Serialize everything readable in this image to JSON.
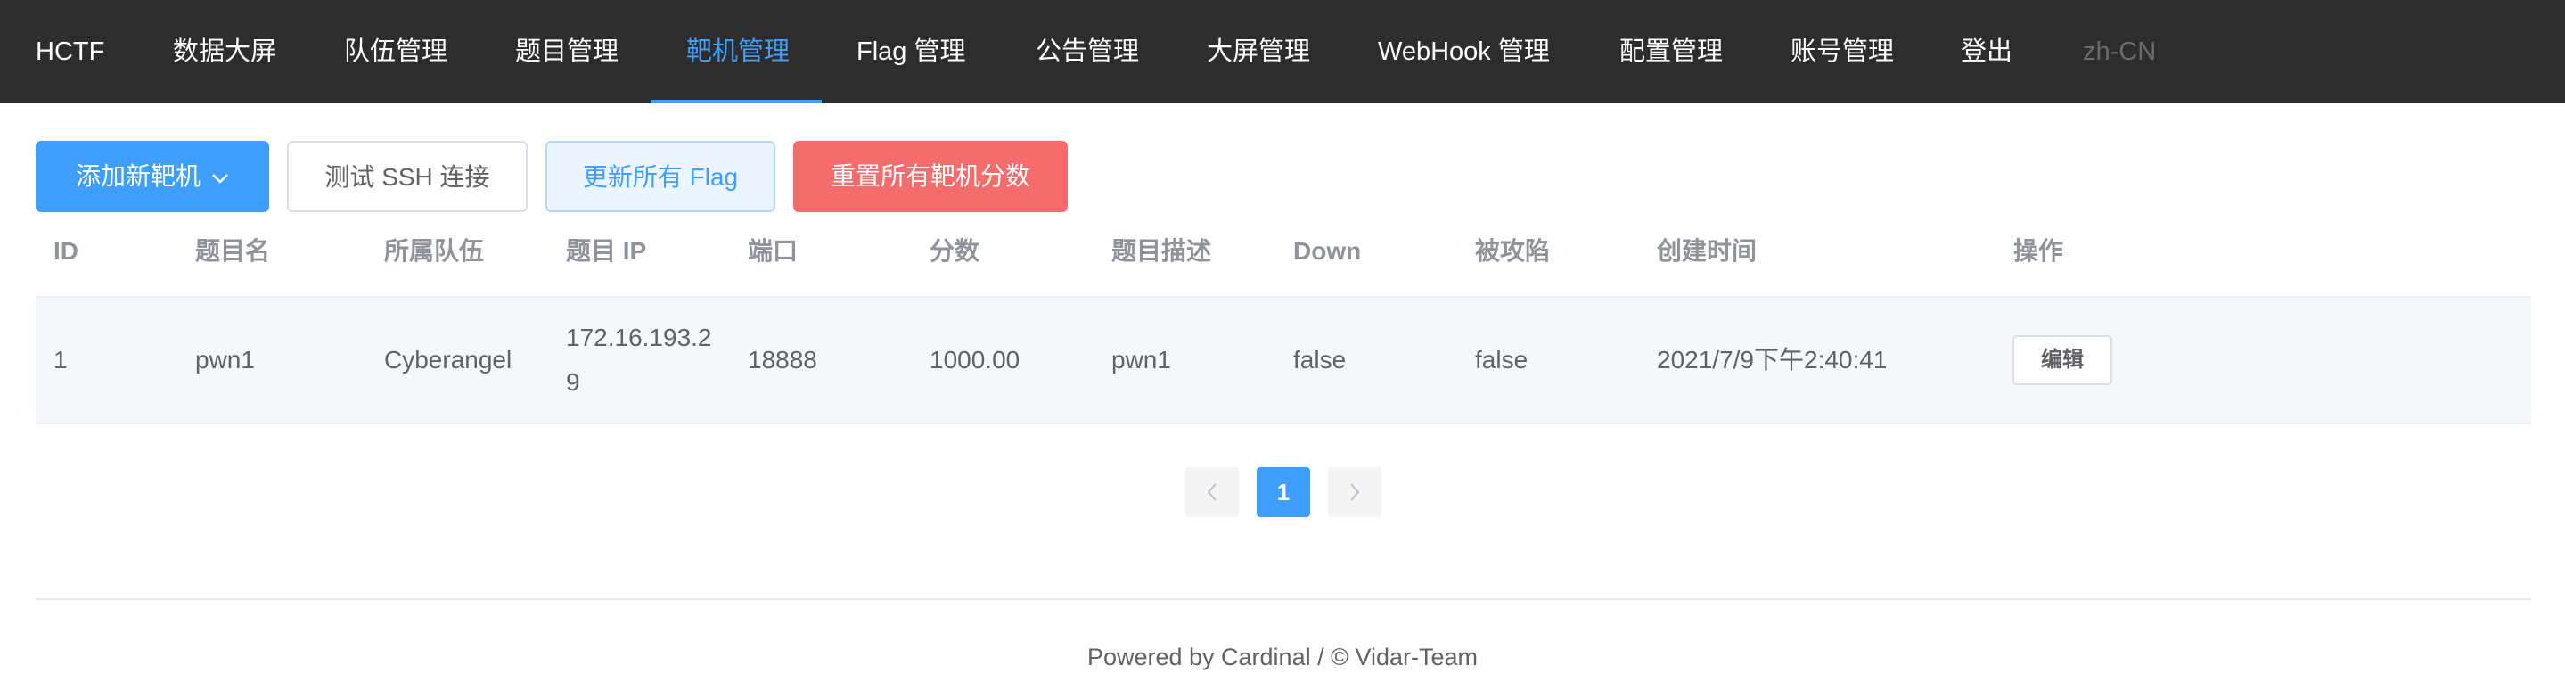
{
  "nav": {
    "brand": "HCTF",
    "items": [
      "数据大屏",
      "队伍管理",
      "题目管理",
      "靶机管理",
      "Flag 管理",
      "公告管理",
      "大屏管理",
      "WebHook 管理",
      "配置管理",
      "账号管理",
      "登出"
    ],
    "active_index": 3,
    "language": "zh-CN"
  },
  "toolbar": {
    "add_label": "添加新靶机",
    "test_ssh_label": "测试 SSH 连接",
    "refresh_flag_label": "更新所有 Flag",
    "reset_score_label": "重置所有靶机分数"
  },
  "table": {
    "columns": [
      "ID",
      "题目名",
      "所属队伍",
      "题目 IP",
      "端口",
      "分数",
      "题目描述",
      "Down",
      "被攻陷",
      "创建时间",
      "操作"
    ],
    "rows": [
      {
        "id": "1",
        "name": "pwn1",
        "team": "Cyberangel",
        "ip": "172.16.193.29",
        "port": "18888",
        "score": "1000.00",
        "description": "pwn1",
        "down": "false",
        "attacked": "false",
        "created": "2021/7/9下午2:40:41",
        "action_label": "编辑"
      }
    ]
  },
  "pagination": {
    "prev_icon": "chevron-left-icon",
    "next_icon": "chevron-right-icon",
    "current_page": "1"
  },
  "footer": {
    "text": "Powered by Cardinal / © Vidar-Team"
  },
  "colors": {
    "navbar_bg": "#2d2d2d",
    "accent": "#409eff",
    "danger": "#f56c6c",
    "row_hover": "#f5f7fa"
  }
}
